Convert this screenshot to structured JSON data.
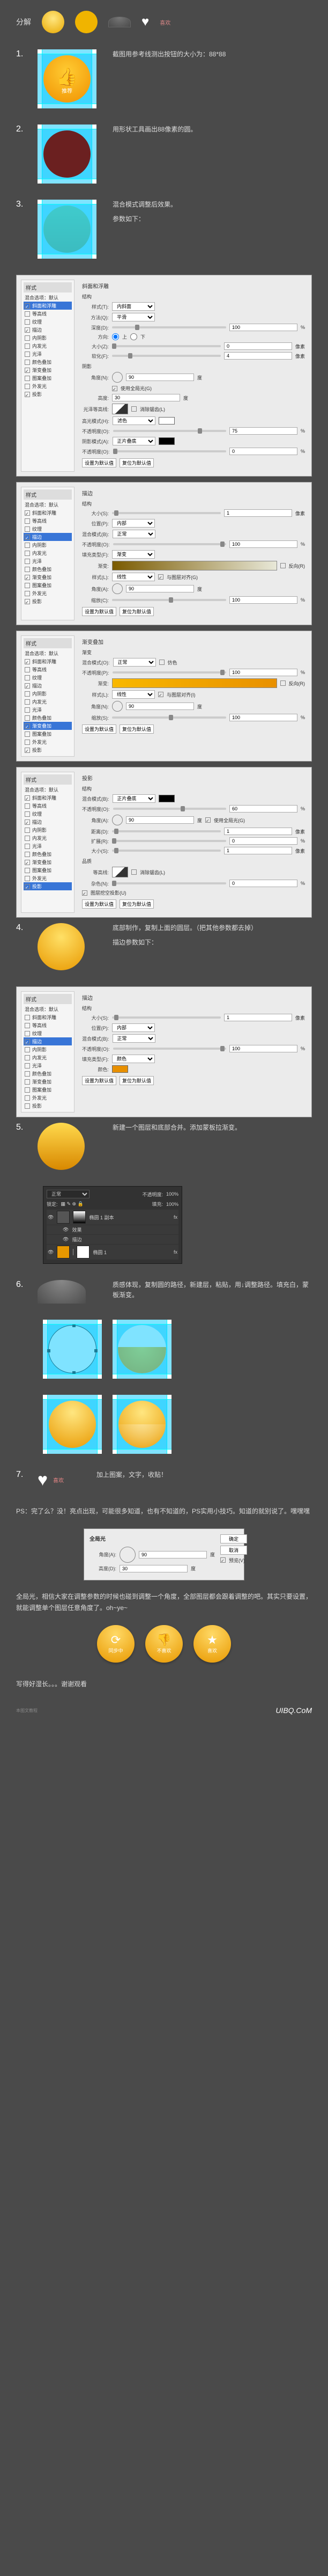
{
  "header": {
    "title": "分解",
    "sampleText": "喜欢"
  },
  "steps": {
    "s1": {
      "num": "1.",
      "desc": "截图用参考线测出按钮的大小为：88*88",
      "btnLabel": "推荐"
    },
    "s2": {
      "num": "2.",
      "desc": "用形状工具画出88像素的圆。"
    },
    "s3": {
      "num": "3.",
      "desc1": "混合模式调整后效果。",
      "desc2": "参数如下："
    },
    "s4": {
      "num": "4.",
      "desc1": "底部制作，复制上面的圆层。（把其他参数都去掉）",
      "desc2": "描边参数如下："
    },
    "s5": {
      "num": "5.",
      "desc": "新建一个图层和底部合并。添加蒙板拉渐变。"
    },
    "s6": {
      "num": "6.",
      "desc": "质感体现，复制圆的路径，新建层，粘贴，用↓调整路径。填充白，蒙板渐变。"
    },
    "s7": {
      "num": "7.",
      "desc": "加上图案，文字，收贴！",
      "text": "喜欢"
    }
  },
  "panelLeft": {
    "groupTitle": "样式",
    "blendDefault": "混合选项：默认",
    "items": [
      "斜面和浮雕",
      "等高线",
      "纹理",
      "描边",
      "内阴影",
      "内发光",
      "光泽",
      "颜色叠加",
      "渐变叠加",
      "图案叠加",
      "外发光",
      "投影"
    ]
  },
  "p_bevel": {
    "title": "斜面和浮雕",
    "structLabel": "结构",
    "style": "样式(T):",
    "styleVal": "内斜面",
    "method": "方法(Q):",
    "methodVal": "平滑",
    "depth": "深度(D):",
    "depthVal": "100",
    "pct": "%",
    "dir": "方向:",
    "up": "上",
    "down": "下",
    "size": "大小(Z):",
    "sizeVal": "0",
    "px": "像素",
    "soften": "软化(F):",
    "softenVal": "4",
    "shadeLabel": "阴影",
    "angle": "角度(N):",
    "angleVal": "90",
    "deg": "度",
    "global": "使用全局光(G)",
    "altitude": "高度:",
    "altitudeVal": "30",
    "contour": "光泽等高线:",
    "antialias": "消除锯齿(L)",
    "hlMode": "高光模式(H):",
    "hlModeVal": "滤色",
    "opacity": "不透明度(O):",
    "hlOpVal": "75",
    "shMode": "阴影模式(A):",
    "shModeVal": "正片叠底",
    "shOpVal": "0",
    "defaultBtn": "设置为默认值",
    "resetBtn": "复位为默认值"
  },
  "p_stroke": {
    "title": "描边",
    "struct": "结构",
    "size": "大小(S):",
    "sizeVal": "1",
    "px": "像素",
    "pos": "位置(P):",
    "posVal": "内部",
    "blend": "混合模式(B):",
    "blendVal": "正常",
    "op": "不透明度(O):",
    "opVal": "100",
    "pct": "%",
    "fillType": "填充类型(F):",
    "fillTypeVal": "渐变",
    "grad": "渐变:",
    "reverse": "反向(R)",
    "style": "样式(L):",
    "styleVal": "线性",
    "align": "与图层对齐(G)",
    "angle": "角度(A):",
    "angleVal": "90",
    "deg": "度",
    "scale": "缩放(C):",
    "scaleVal": "100"
  },
  "p_gradOverlay": {
    "title": "渐变叠加",
    "gradLabel": "渐变",
    "blend": "混合模式(O):",
    "blendVal": "正常",
    "dither": "仿色",
    "op": "不透明度(P):",
    "opVal": "100",
    "pct": "%",
    "grad": "渐变:",
    "reverse": "反向(R)",
    "style": "样式(L):",
    "styleVal": "线性",
    "align": "与图层对齐(I)",
    "angle": "角度(N):",
    "angleVal": "90",
    "deg": "度",
    "scale": "缩放(S):",
    "scaleVal": "100"
  },
  "p_shadow": {
    "title": "投影",
    "struct": "结构",
    "blend": "混合模式(B):",
    "blendVal": "正片叠底",
    "op": "不透明度(O):",
    "opVal": "60",
    "pct": "%",
    "angle": "角度(A):",
    "angleVal": "90",
    "deg": "度",
    "global": "使用全局光(G)",
    "dist": "距离(D):",
    "distVal": "1",
    "px": "像素",
    "spread": "扩展(R):",
    "spreadVal": "0",
    "size": "大小(S):",
    "sizeVal": "1",
    "quality": "品质",
    "contour": "等高线:",
    "antialias": "消除锯齿(L)",
    "noise": "杂色(N):",
    "noiseVal": "0",
    "knockout": "图层挖空投影(U)"
  },
  "p_stroke2": {
    "title": "描边",
    "struct": "结构",
    "size": "大小(S):",
    "sizeVal": "1",
    "px": "像素",
    "pos": "位置(P):",
    "posVal": "内部",
    "blend": "混合模式(B):",
    "blendVal": "正常",
    "op": "不透明度(O):",
    "opVal": "100",
    "pct": "%",
    "fillType": "填充类型(F):",
    "fillTypeVal": "颜色",
    "color": "颜色:"
  },
  "layers": {
    "tab": "正常",
    "opLabel": "不透明度:",
    "opVal": "100%",
    "lock": "锁定:",
    "fillLabel": "填充:",
    "fillVal": "100%",
    "fxLabel": "效果",
    "strokeLabel": "描边",
    "name1": "椭圆 1 副本",
    "name2": "椭圆 1",
    "fx": "fx"
  },
  "globalLight": {
    "title": "全局光",
    "angle": "角度(A):",
    "angleVal": "90",
    "deg": "度",
    "altitude": "高度(D):",
    "altitudeVal": "30",
    "ok": "确定",
    "cancel": "取消",
    "preview": "预览(V)"
  },
  "footer": {
    "ps": "PS：完了么？没！亮点出现，可能很多知道，也有不知道的，PS实用小技巧。知道的就别说了。嘿嘿嘿",
    "global": "全局光，相信大家在调整参数的时候也碰到调整一个角度，全部图层都会跟着调整的吧。其实只要设置，就能调整单个图层任意角度了。oh~ye~",
    "closing": "写得好湿长。。。谢谢观看",
    "btn1": "同步中",
    "btn2": "不喜欢",
    "btn3": "喜欢",
    "watermark": "本图文教程",
    "site": "UIBQ.CoM"
  }
}
